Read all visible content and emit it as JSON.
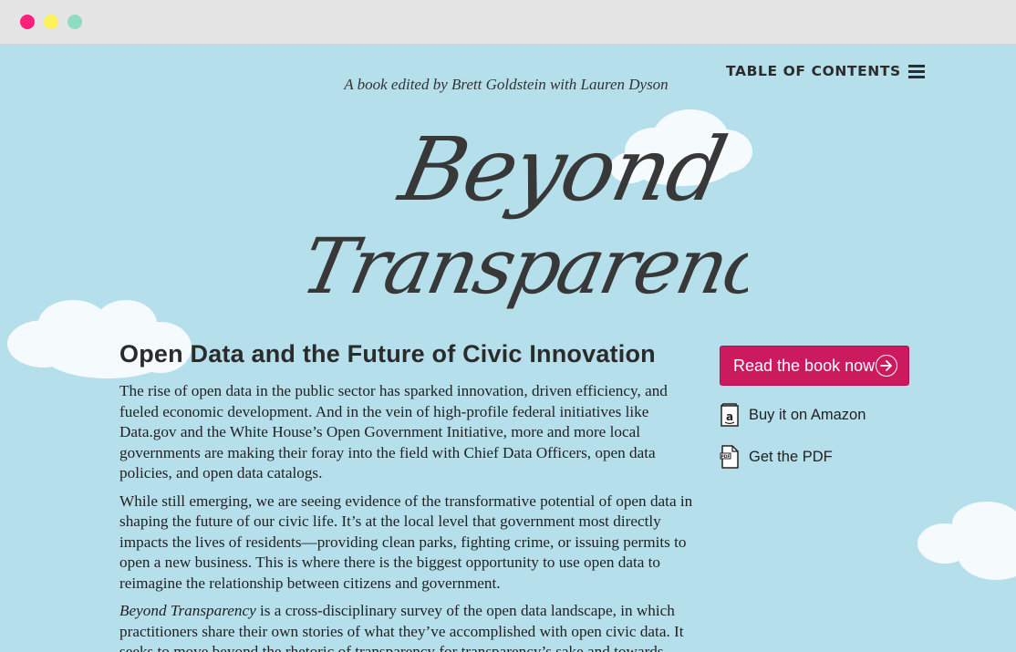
{
  "window": {
    "controls": [
      "close",
      "minimize",
      "zoom"
    ]
  },
  "header": {
    "toc_label": "TABLE OF CONTENTS",
    "toc_icon": "hamburger-menu-icon",
    "byline": "A book edited by Brett Goldstein with Lauren Dyson"
  },
  "hero": {
    "title_line1": "Beyond",
    "title_line2": "Transparency"
  },
  "main": {
    "section_title": "Open Data and the Future of Civic Innovation",
    "paragraph1": "The rise of open data in the public sector has sparked innovation, driven efficiency, and fueled economic development. And in the vein of high-profile federal initiatives like Data.gov and the White House’s Open Government Initiative, more and more local governments are making their foray into the field with Chief Data Officers, open data policies, and open data catalogs.",
    "paragraph2": "While still emerging, we are seeing evidence of the transformative potential of open data in shaping the future of our civic life. It’s at the local level that government most directly impacts the lives of residents—providing clean parks, fighting crime, or issuing permits to open a new business. This is where there is the biggest opportunity to use open data to reimagine the relationship between citizens and government.",
    "paragraph3_em": "Beyond Transparency",
    "paragraph3_rest": " is a cross-disciplinary survey of the open data landscape, in which practitioners share their own stories of what they’ve accomplished with open civic data. It seeks to move beyond the rhetoric of transparency for transparency’s sake and towards"
  },
  "sidebar": {
    "read_button": "Read the book now",
    "amazon_link": "Buy it on Amazon",
    "pdf_link": "Get the PDF",
    "accent_color": "#cc1a5f"
  },
  "colors": {
    "background": "#b6dfec",
    "cloud": "#f5fafc",
    "text": "#2c2c2c"
  }
}
